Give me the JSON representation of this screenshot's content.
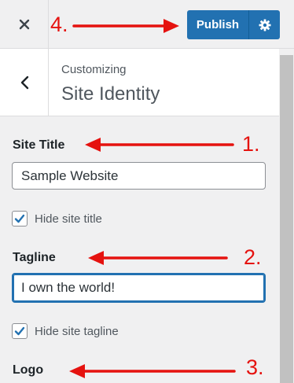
{
  "topbar": {
    "close_icon": "close-icon",
    "publish_label": "Publish",
    "gear_icon": "gear-icon",
    "accent": "#2271b1"
  },
  "header": {
    "back_icon": "chevron-left-icon",
    "crumb": "Customizing",
    "title": "Site Identity"
  },
  "form": {
    "site_title_label": "Site Title",
    "site_title_value": "Sample Website",
    "hide_site_title_label": "Hide site title",
    "hide_site_title_checked": true,
    "tagline_label": "Tagline",
    "tagline_value": "I own the world!",
    "hide_tagline_label": "Hide site tagline",
    "hide_tagline_checked": true,
    "logo_label": "Logo"
  },
  "annotations": {
    "color": "#e5120f",
    "markers": [
      "1.",
      "2.",
      "3.",
      "4."
    ]
  }
}
